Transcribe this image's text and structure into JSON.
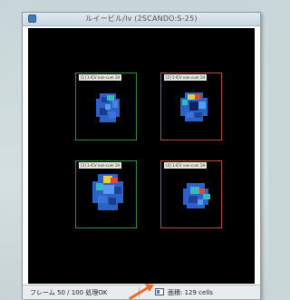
{
  "window": {
    "title": "ルイービル/lv  (2SCANDO:S-25)"
  },
  "rois": [
    {
      "label": "[1] 1-ICV non-cum 1H",
      "color": "#2f8a3e"
    },
    {
      "label": "[2] 1-ICV non-cum 1H",
      "color": "#b24c35"
    },
    {
      "label": "[3] 1-ICV non-cum 1H",
      "color": "#2f8a3e"
    },
    {
      "label": "[4] 1-ICV non-cum 1H",
      "color": "#b24c35"
    }
  ],
  "status": {
    "frames": "フレーム 50 / 100  処理OK",
    "area": "面積: 129 cells"
  },
  "colors": {
    "canvas": "#000000",
    "cell_base": "#2a62c8",
    "cell_hot": "#e0d040",
    "cell_warm": "#e04a30",
    "cell_mid": "#38b8c0",
    "arrow": "#e86a2a"
  }
}
